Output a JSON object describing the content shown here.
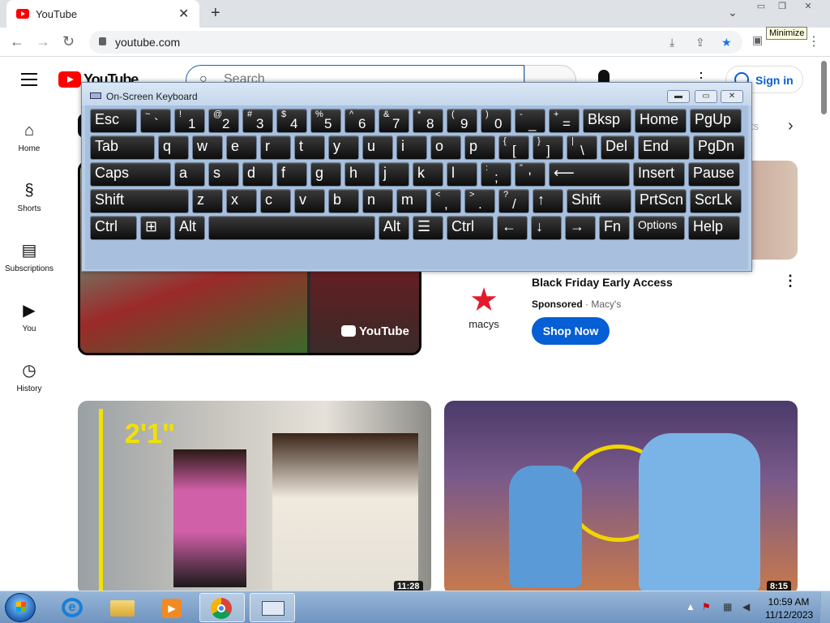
{
  "browser": {
    "tab_title": "YouTube",
    "new_tab": "+",
    "tab_close": "✕",
    "url": "youtube.com",
    "tooltip": "Minimize",
    "tab_search": "⌄"
  },
  "youtube": {
    "logo_text": "YouTube",
    "search_placeholder": "Search",
    "sign_in": "Sign in",
    "nav": [
      {
        "label": "Home",
        "icon": "home-icon"
      },
      {
        "label": "Shorts",
        "icon": "shorts-icon"
      },
      {
        "label": "Subscriptions",
        "icon": "subscriptions-icon"
      },
      {
        "label": "You",
        "icon": "you-icon"
      },
      {
        "label": "History",
        "icon": "history-icon"
      }
    ],
    "chip_fragment": "ts",
    "ad": {
      "title": "Black Friday Early Access",
      "sponsored": "Sponsored",
      "advertiser": "Macy's",
      "button": "Shop Now",
      "logo_text": "macys",
      "video_watermark": "YouTube"
    },
    "videos": [
      {
        "duration": "11:28",
        "overlay_text": "2'1\""
      },
      {
        "duration": "8:15"
      }
    ]
  },
  "osk": {
    "title": "On-Screen Keyboard",
    "rows": [
      [
        {
          "m": "Esc"
        },
        {
          "u": "~",
          "l": "`"
        },
        {
          "u": "!",
          "l": "1"
        },
        {
          "u": "@",
          "l": "2"
        },
        {
          "u": "#",
          "l": "3"
        },
        {
          "u": "$",
          "l": "4"
        },
        {
          "u": "%",
          "l": "5"
        },
        {
          "u": "^",
          "l": "6"
        },
        {
          "u": "&",
          "l": "7"
        },
        {
          "u": "*",
          "l": "8"
        },
        {
          "u": "(",
          "l": "9"
        },
        {
          "u": ")",
          "l": "0"
        },
        {
          "u": "-",
          "l": "_"
        },
        {
          "u": "+",
          "l": "="
        },
        {
          "m": "Bksp"
        },
        {
          "m": "Home"
        },
        {
          "m": "PgUp"
        }
      ],
      [
        {
          "m": "Tab"
        },
        {
          "m": "q"
        },
        {
          "m": "w"
        },
        {
          "m": "e"
        },
        {
          "m": "r"
        },
        {
          "m": "t"
        },
        {
          "m": "y"
        },
        {
          "m": "u"
        },
        {
          "m": "i"
        },
        {
          "m": "o"
        },
        {
          "m": "p"
        },
        {
          "u": "{",
          "l": "["
        },
        {
          "u": "}",
          "l": "]"
        },
        {
          "u": "|",
          "l": "\\"
        },
        {
          "m": "Del"
        },
        {
          "m": "End"
        },
        {
          "m": "PgDn"
        }
      ],
      [
        {
          "m": "Caps"
        },
        {
          "m": "a"
        },
        {
          "m": "s"
        },
        {
          "m": "d"
        },
        {
          "m": "f"
        },
        {
          "m": "g"
        },
        {
          "m": "h"
        },
        {
          "m": "j"
        },
        {
          "m": "k"
        },
        {
          "m": "l"
        },
        {
          "u": ":",
          "l": ";"
        },
        {
          "u": "\"",
          "l": "'"
        },
        {
          "m": "⟵"
        },
        {
          "m": "Insert"
        },
        {
          "m": "Pause"
        }
      ],
      [
        {
          "m": "Shift"
        },
        {
          "m": "z"
        },
        {
          "m": "x"
        },
        {
          "m": "c"
        },
        {
          "m": "v"
        },
        {
          "m": "b"
        },
        {
          "m": "n"
        },
        {
          "m": "m"
        },
        {
          "u": "<",
          "l": ","
        },
        {
          "u": ">",
          "l": "."
        },
        {
          "u": "?",
          "l": "/"
        },
        {
          "m": "↑"
        },
        {
          "m": "Shift"
        },
        {
          "m": "PrtScn"
        },
        {
          "m": "ScrLk"
        }
      ],
      [
        {
          "m": "Ctrl"
        },
        {
          "m": "⊞"
        },
        {
          "m": "Alt"
        },
        {
          "m": ""
        },
        {
          "m": "Alt"
        },
        {
          "m": "☰"
        },
        {
          "m": "Ctrl"
        },
        {
          "m": "←"
        },
        {
          "m": "↓"
        },
        {
          "m": "→"
        },
        {
          "m": "Fn"
        },
        {
          "m": "Options"
        },
        {
          "m": "Help"
        }
      ]
    ]
  },
  "taskbar": {
    "time": "10:59 AM",
    "date": "11/12/2023",
    "apps": [
      "internet-explorer-icon",
      "file-explorer-icon",
      "media-player-icon",
      "chrome-icon",
      "on-screen-keyboard-icon"
    ]
  }
}
